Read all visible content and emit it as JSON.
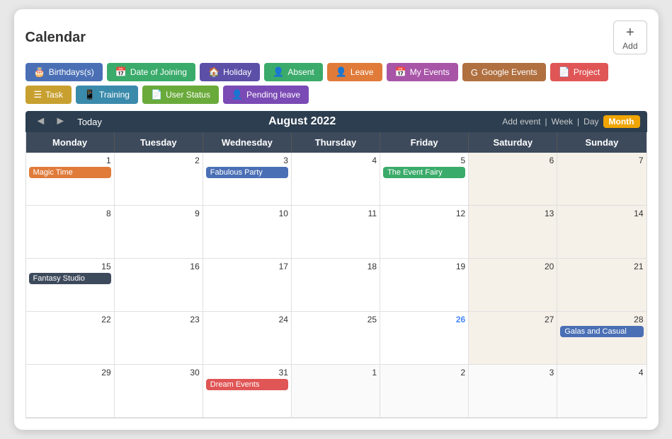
{
  "header": {
    "title": "Calendar",
    "add_label": "Add",
    "add_icon": "+"
  },
  "filters": [
    {
      "id": "birthdays",
      "label": "Birthdays(s)",
      "icon": "🎂",
      "color": "#4a6fb5"
    },
    {
      "id": "date-of-joining",
      "label": "Date of Joining",
      "icon": "📅",
      "color": "#3aab6a"
    },
    {
      "id": "holiday",
      "label": "Holiday",
      "icon": "🏠",
      "color": "#5b4fa8"
    },
    {
      "id": "absent",
      "label": "Absent",
      "icon": "👤",
      "color": "#3aab6a"
    },
    {
      "id": "leave",
      "label": "Leave",
      "icon": "👤",
      "color": "#e07b3a"
    },
    {
      "id": "my-events",
      "label": "My Events",
      "icon": "📅",
      "color": "#a855a8"
    },
    {
      "id": "google-events",
      "label": "Google Events",
      "icon": "G",
      "color": "#b07040"
    },
    {
      "id": "project",
      "label": "Project",
      "icon": "📄",
      "color": "#e05555"
    },
    {
      "id": "task",
      "label": "Task",
      "icon": "☰",
      "color": "#c8a030"
    },
    {
      "id": "training",
      "label": "Training",
      "icon": "📱",
      "color": "#3a8aab"
    },
    {
      "id": "user-status",
      "label": "User Status",
      "icon": "📄",
      "color": "#6aaa3a"
    },
    {
      "id": "pending-leave",
      "label": "Pending leave",
      "icon": "👤",
      "color": "#7a4ab5"
    }
  ],
  "nav": {
    "prev_label": "◄",
    "next_label": "►",
    "today_label": "Today",
    "month_title": "August 2022",
    "add_event_label": "Add event",
    "week_label": "Week",
    "day_label": "Day",
    "month_label": "Month",
    "separator": "|"
  },
  "day_headers": [
    "Monday",
    "Tuesday",
    "Wednesday",
    "Thursday",
    "Friday",
    "Saturday",
    "Sunday"
  ],
  "weeks": [
    [
      {
        "num": "1",
        "events": [
          {
            "label": "Magic Time",
            "color": "#e07b3a"
          }
        ],
        "weekend": false,
        "other": false
      },
      {
        "num": "2",
        "events": [],
        "weekend": false,
        "other": false
      },
      {
        "num": "3",
        "events": [
          {
            "label": "Fabulous Party",
            "color": "#4a6fb5"
          }
        ],
        "weekend": false,
        "other": false
      },
      {
        "num": "4",
        "events": [],
        "weekend": false,
        "other": false
      },
      {
        "num": "5",
        "events": [
          {
            "label": "The Event Fairy",
            "color": "#3aab6a"
          }
        ],
        "weekend": false,
        "other": false
      },
      {
        "num": "6",
        "events": [],
        "weekend": true,
        "other": false
      },
      {
        "num": "7",
        "events": [],
        "weekend": true,
        "other": false
      }
    ],
    [
      {
        "num": "8",
        "events": [],
        "weekend": false,
        "other": false
      },
      {
        "num": "9",
        "events": [],
        "weekend": false,
        "other": false
      },
      {
        "num": "10",
        "events": [],
        "weekend": false,
        "other": false
      },
      {
        "num": "11",
        "events": [],
        "weekend": false,
        "other": false
      },
      {
        "num": "12",
        "events": [],
        "weekend": false,
        "other": false
      },
      {
        "num": "13",
        "events": [],
        "weekend": true,
        "other": false
      },
      {
        "num": "14",
        "events": [],
        "weekend": true,
        "other": false
      }
    ],
    [
      {
        "num": "15",
        "events": [
          {
            "label": "Fantasy Studio",
            "color": "#3d4a5c"
          }
        ],
        "weekend": false,
        "other": false
      },
      {
        "num": "16",
        "events": [],
        "weekend": false,
        "other": false
      },
      {
        "num": "17",
        "events": [],
        "weekend": false,
        "other": false
      },
      {
        "num": "18",
        "events": [],
        "weekend": false,
        "other": false
      },
      {
        "num": "19",
        "events": [],
        "weekend": false,
        "other": false
      },
      {
        "num": "20",
        "events": [],
        "weekend": true,
        "other": false
      },
      {
        "num": "21",
        "events": [],
        "weekend": true,
        "other": false
      }
    ],
    [
      {
        "num": "22",
        "events": [],
        "weekend": false,
        "other": false
      },
      {
        "num": "23",
        "events": [],
        "weekend": false,
        "other": false
      },
      {
        "num": "24",
        "events": [],
        "weekend": false,
        "other": false
      },
      {
        "num": "25",
        "events": [],
        "weekend": false,
        "other": false
      },
      {
        "num": "26",
        "events": [],
        "weekend": false,
        "highlighted": true,
        "other": false
      },
      {
        "num": "27",
        "events": [],
        "weekend": true,
        "other": false
      },
      {
        "num": "28",
        "events": [
          {
            "label": "Galas and Casual",
            "color": "#4a6fb5"
          }
        ],
        "weekend": true,
        "other": false
      }
    ],
    [
      {
        "num": "29",
        "events": [],
        "weekend": false,
        "other": false
      },
      {
        "num": "30",
        "events": [],
        "weekend": false,
        "other": false
      },
      {
        "num": "31",
        "events": [
          {
            "label": "Dream Events",
            "color": "#e05555"
          }
        ],
        "weekend": false,
        "other": false
      },
      {
        "num": "1",
        "events": [],
        "weekend": false,
        "other": true
      },
      {
        "num": "2",
        "events": [],
        "weekend": false,
        "other": true
      },
      {
        "num": "3",
        "events": [],
        "weekend": true,
        "other": true
      },
      {
        "num": "4",
        "events": [],
        "weekend": true,
        "other": true
      }
    ]
  ]
}
